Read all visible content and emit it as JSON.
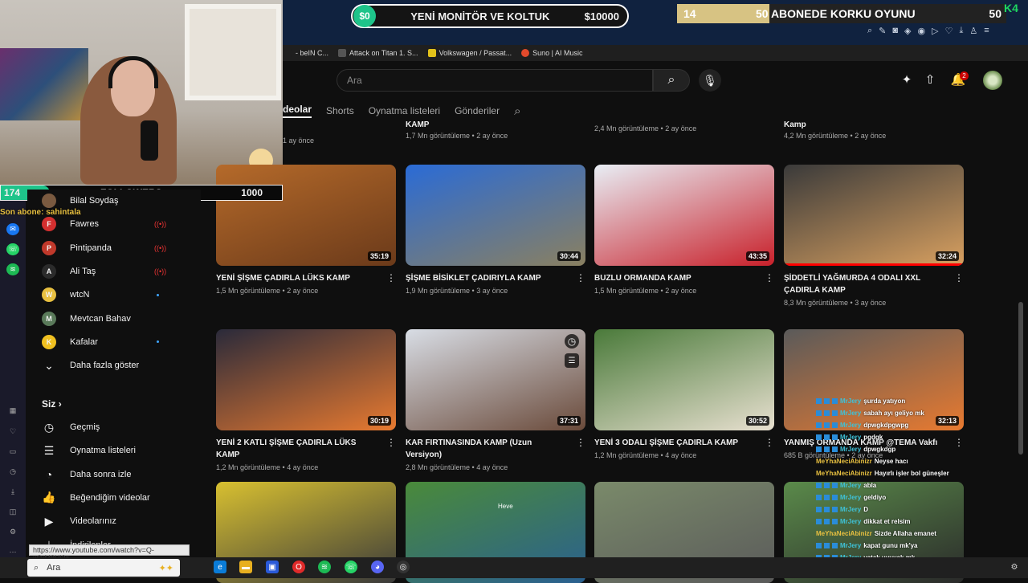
{
  "overlay": {
    "goal1": {
      "current": "$0",
      "title": "YENİ MONİTÖR VE KOLTUK",
      "target": "$10000",
      "progress": 0
    },
    "goal2": {
      "current": "14",
      "title": "50 ABONEDE KORKU OYUNU",
      "target": "50",
      "progress": 0.28
    },
    "followers": {
      "current": "174",
      "label": "FOLLOWERS",
      "target": "1000",
      "progress": 0.174
    },
    "sub_alert": "Son abone: sahintala",
    "k_badge": "K4"
  },
  "bookmarks": [
    {
      "label": "- beIN C...",
      "color": "#1f1f1f"
    },
    {
      "label": "Attack on Titan 1. S...",
      "color": "#555555"
    },
    {
      "label": "Volkswagen / Passat...",
      "color": "#e3c21a"
    },
    {
      "label": "Suno | AI Music",
      "color": "#e24a2c"
    }
  ],
  "search": {
    "placeholder": "Ara"
  },
  "notifications": {
    "count": "2"
  },
  "tabs": [
    "deolar",
    "Shorts",
    "Oynatma listeleri",
    "Gönderiler"
  ],
  "sidebar": {
    "subscriptions": [
      {
        "name": "Bilal Soydaş",
        "avatar_color": "#7a5a40",
        "initial": "",
        "status": "none"
      },
      {
        "name": "Fawres",
        "avatar_color": "#d32f2f",
        "initial": "F",
        "status": "live"
      },
      {
        "name": "Pintipanda",
        "avatar_color": "#c0392b",
        "initial": "P",
        "status": "live"
      },
      {
        "name": "Ali Taş",
        "avatar_color": "#2b2b2b",
        "initial": "A",
        "status": "live"
      },
      {
        "name": "wtcN",
        "avatar_color": "#e8c040",
        "initial": "W",
        "status": "new"
      },
      {
        "name": "Mevtcan Bahav",
        "avatar_color": "#5a7a5a",
        "initial": "M",
        "status": "none"
      },
      {
        "name": "Kafalar",
        "avatar_color": "#f0c020",
        "initial": "K",
        "status": "new"
      }
    ],
    "show_more": "Daha fazla göster",
    "you_header": "Siz",
    "you_items": [
      {
        "label": "Geçmiş",
        "icon": "history-icon",
        "glyph": "◷"
      },
      {
        "label": "Oynatma listeleri",
        "icon": "playlists-icon",
        "glyph": "☰"
      },
      {
        "label": "Daha sonra izle",
        "icon": "watch-later-icon",
        "glyph": "◔"
      },
      {
        "label": "Beğendiğim videolar",
        "icon": "liked-icon",
        "glyph": "👍"
      },
      {
        "label": "Videolarınız",
        "icon": "your-videos-icon",
        "glyph": "▶"
      },
      {
        "label": "İndirilenler",
        "icon": "downloads-icon",
        "glyph": "⤓"
      }
    ]
  },
  "status_url": "https://www.youtube.com/watch?v=Q-xOrM8Uj2s",
  "top_row": [
    {
      "title": "",
      "meta": "1 ay önce"
    },
    {
      "title": "KAMP",
      "meta": "1,7 Mn görüntüleme • 2 ay önce"
    },
    {
      "title": "",
      "meta": "2,4 Mn görüntüleme • 2 ay önce"
    },
    {
      "title": "Kamp",
      "meta": "4,2 Mn görüntüleme • 2 ay önce"
    }
  ],
  "videos": [
    {
      "title": "YENİ ŞİŞME ÇADIRLA LÜKS KAMP",
      "meta": "1,5 Mn görüntüleme • 2 ay önce",
      "duration": "35:19",
      "colors": [
        "#b56a2a",
        "#6b3a1a"
      ]
    },
    {
      "title": "ŞİŞME BİSİKLET ÇADIRIYLA KAMP",
      "meta": "1,9 Mn görüntüleme • 3 ay önce",
      "duration": "30:44",
      "colors": [
        "#2a6bd6",
        "#8a8060"
      ]
    },
    {
      "title": "BUZLU ORMANDA KAMP",
      "meta": "1,5 Mn görüntüleme • 2 ay önce",
      "duration": "43:35",
      "colors": [
        "#e8eef5",
        "#c8202a"
      ]
    },
    {
      "title": "ŞİDDETLİ YAĞMURDA 4 ODALI XXL ÇADIRLA KAMP",
      "meta": "8,3 Mn görüntüleme • 3 ay önce",
      "duration": "32:24",
      "colors": [
        "#3a3a3a",
        "#d8a060"
      ]
    },
    {
      "title": "YENİ 2 KATLI ŞİŞME ÇADIRLA LÜKS KAMP",
      "meta": "1,2 Mn görüntüleme • 4 ay önce",
      "duration": "30:19",
      "colors": [
        "#2a2a3a",
        "#e87a30"
      ]
    },
    {
      "title": "KAR FIRTINASINDA KAMP (Uzun Versiyon)",
      "meta": "2,8 Mn görüntüleme • 4 ay önce",
      "duration": "37:31",
      "colors": [
        "#d8dde5",
        "#6a4a3a"
      ]
    },
    {
      "title": "YENİ 3 ODALI ŞİŞME ÇADIRLA KAMP",
      "meta": "1,2 Mn görüntüleme • 4 ay önce",
      "duration": "30:52",
      "colors": [
        "#4a7a3a",
        "#e8e0d0"
      ]
    },
    {
      "title": "YANMIŞ ORMANDA KAMP @TEMA Vakfı",
      "meta": "685 B görüntüleme • 2 ay önce",
      "duration": "32:13",
      "colors": [
        "#5a5a5a",
        "#e87a30"
      ]
    },
    {
      "title": "",
      "meta": "",
      "duration": "",
      "colors": [
        "#d8c030",
        "#3a3a3a"
      ]
    },
    {
      "title": "",
      "meta": "",
      "duration": "",
      "colors": [
        "#4a8a3a",
        "#2a6090"
      ]
    },
    {
      "title": "",
      "meta": "",
      "duration": "",
      "colors": [
        "#7a8a6a",
        "#5a5a5a"
      ]
    },
    {
      "title": "",
      "meta": "",
      "duration": "",
      "colors": [
        "#5a8a4a",
        "#2a2a2a"
      ]
    }
  ],
  "thumb_label": "Heve",
  "chat": [
    {
      "user": "MrJery",
      "msg": "şurda yatıyon",
      "style": "u"
    },
    {
      "user": "MrJery",
      "msg": "sabah ayı geliyo mk",
      "style": "u"
    },
    {
      "user": "MrJery",
      "msg": "dpwgkdpgwpg",
      "style": "u"
    },
    {
      "user": "MrJery",
      "msg": "pgdgk",
      "style": "u"
    },
    {
      "user": "MrJery",
      "msg": "dpwgkdgp",
      "style": "u"
    },
    {
      "user": "MeYhaNeciAbinizr",
      "msg": "Neyse hacı",
      "style": "u2"
    },
    {
      "user": "MeYhaNeciAbinizr",
      "msg": "Hayırlı işler bol güneşler",
      "style": "u2"
    },
    {
      "user": "MrJery",
      "msg": "abla",
      "style": "u"
    },
    {
      "user": "MrJery",
      "msg": "geldiyo",
      "style": "u"
    },
    {
      "user": "MrJery",
      "msg": "D",
      "style": "u"
    },
    {
      "user": "MrJery",
      "msg": "dikkat et relsim",
      "style": "u"
    },
    {
      "user": "MeYhaNeciAbinizr",
      "msg": "Sizde Allaha emanet",
      "style": "u2"
    },
    {
      "user": "MrJery",
      "msg": "kapat gunu mk'ya",
      "style": "u"
    },
    {
      "user": "MrJery",
      "msg": "yatak uyuyak mk",
      "style": "u"
    },
    {
      "user": "MrJery",
      "msg": "sikerim şimdi atik ailesini",
      "style": "u"
    }
  ],
  "taskbar": {
    "search_label": "Ara"
  }
}
